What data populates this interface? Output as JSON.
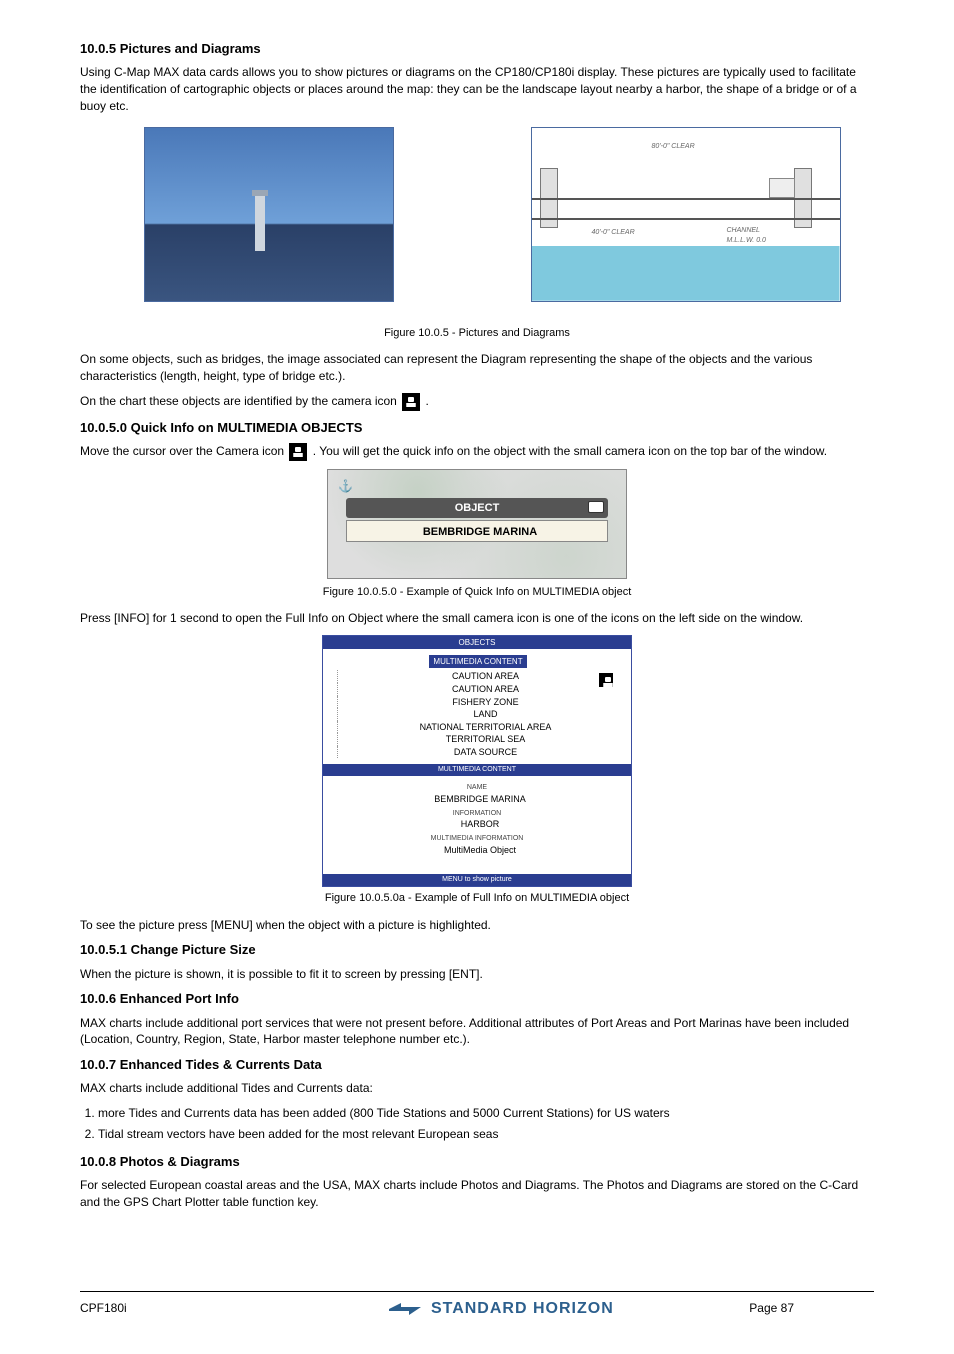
{
  "sections": {
    "pictures_heading": "10.0.5 Pictures and Diagrams",
    "pictures_para": "Using C-Map MAX data cards allows you to show pictures or diagrams on the CP180/CP180i display. These pictures are typically used to facilitate the identification of cartographic objects or places around the map: they can be the landscape layout nearby a harbor, the shape of a bridge or of a buoy etc.",
    "fig1a_caption": "Figure 10.0.5 - Pictures and Diagrams",
    "pictures_para2": [
      "On some objects, such as bridges, the image associated can represent the Diagram representing the shape of the objects and the various characteristics (length, height, type of bridge etc.).",
      "On the chart these objects are identified by the camera icon"
    ],
    "quick_heading": "10.0.5.0 Quick Info on MULTIMEDIA OBJECTS",
    "quick_text_before_icon": "Move the cursor over the Camera icon",
    "quick_text_after_icon": ". You will get the quick info on the object with the small camera icon on the top bar of the window.",
    "obj_header": "OBJECT",
    "obj_name": "BEMBRIDGE MARINA",
    "fig2_caption": "Figure 10.0.5.0 - Example of Quick Info on MULTIMEDIA object",
    "quick_para2": "Press [INFO] for 1 second to open the Full Info on Object where the small camera icon is one of the icons on the left side on the window.",
    "quickinfo": {
      "titlebar": "OBJECTS",
      "tag": "MULTIMEDIA CONTENT",
      "tree": [
        "CAUTION AREA",
        "CAUTION AREA",
        "FISHERY ZONE",
        "LAND",
        "NATIONAL TERRITORIAL AREA",
        "TERRITORIAL SEA",
        "DATA SOURCE"
      ],
      "midbar": "MULTIMEDIA CONTENT",
      "name_lbl": "NAME",
      "name_val": "BEMBRIDGE MARINA",
      "info_lbl": "INFORMATION",
      "info_val": "HARBOR",
      "mm_lbl": "MULTIMEDIA INFORMATION",
      "mm_val": "MultiMedia Object",
      "foot": "MENU to show picture"
    },
    "fig3_caption": "Figure 10.0.5.0a - Example of Full Info on MULTIMEDIA object",
    "steps_intro": "To see the picture press [MENU] when the object with a picture is highlighted.",
    "change_heading": "10.0.5.1 Change Picture Size",
    "change_text": "When the picture is shown, it is possible to fit it to screen by pressing [ENT].",
    "safety_heading": "10.0.6 Enhanced Port Info",
    "safety_text": "MAX charts include additional port services that were not present before. Additional attributes of Port Areas and Port Marinas have been included (Location, Country, Region, State, Harbor master telephone number etc.).",
    "tides_heading": "10.0.7 Enhanced Tides & Currents Data",
    "tides_text1": "MAX charts include additional Tides and Currents data:",
    "tides_list": [
      "more Tides and Currents data has been added (800 Tide Stations and 5000 Current Stations) for US waters",
      "Tidal stream vectors have been added for the most relevant European seas"
    ],
    "satimg_heading": "10.0.8 Photos & Diagrams",
    "satimg_text": "For selected European coastal areas and the USA, MAX charts include Photos and Diagrams. The Photos and Diagrams are stored on the C-Card and the GPS Chart Plotter table function key."
  },
  "diagram_labels": {
    "top": "80'-0\"  CLEAR",
    "left": "40'-0\"  CLEAR",
    "right1": "CHANNEL",
    "right2": "M.L.L.W. 0.0"
  },
  "footer": {
    "model": "CPF180i",
    "brand": "STANDARD HORIZON",
    "page": "Page 87"
  }
}
